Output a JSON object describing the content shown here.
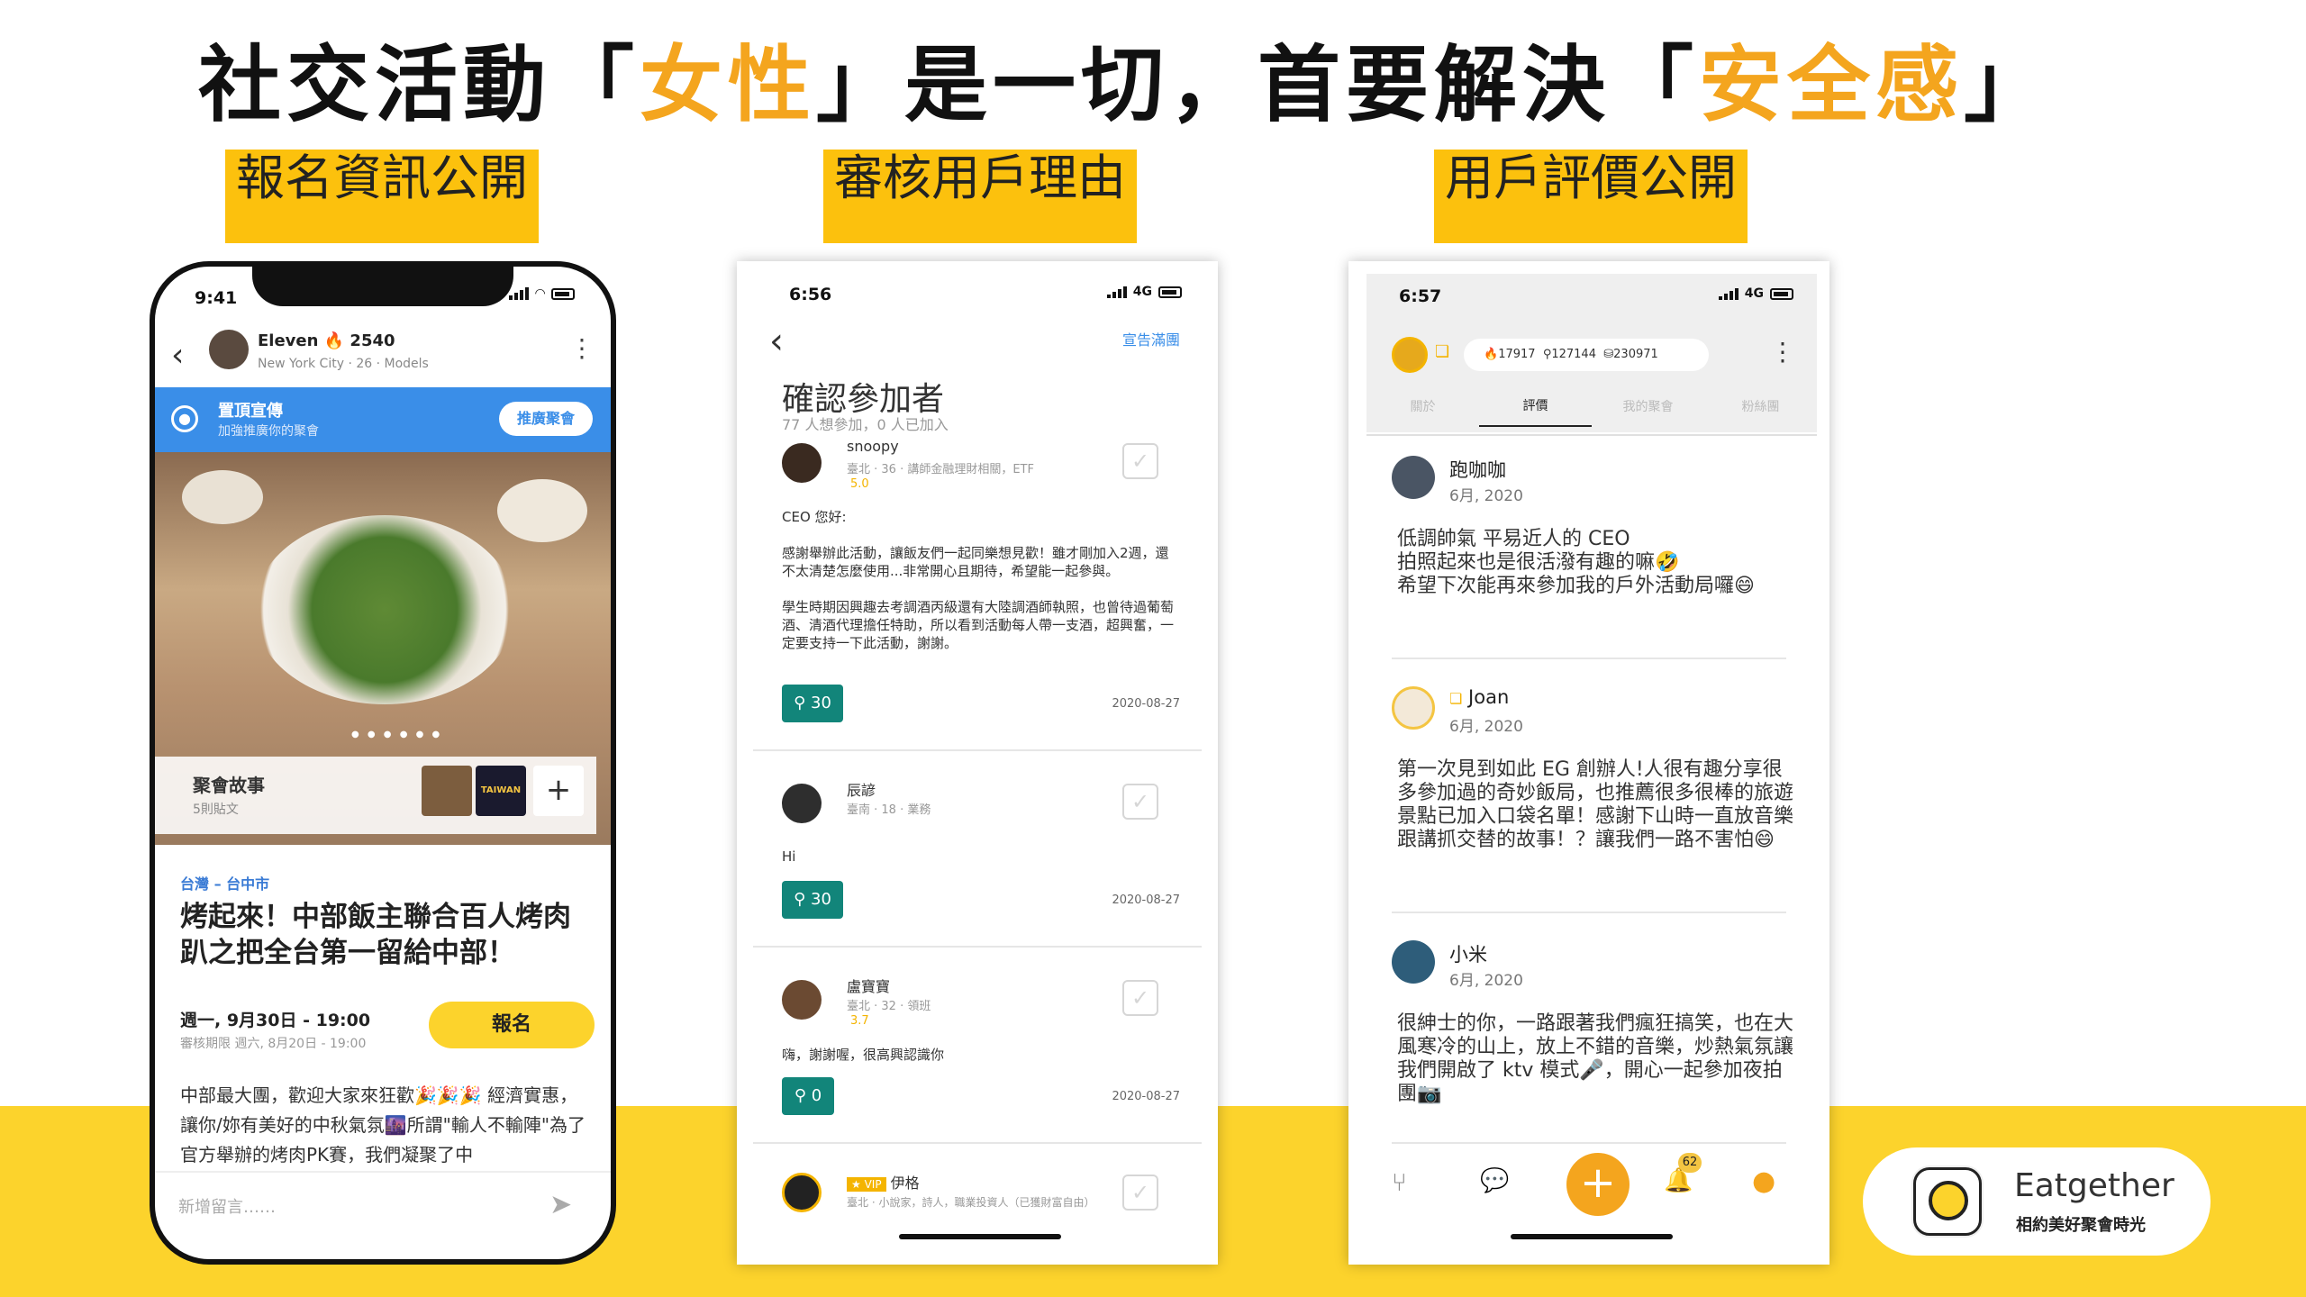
{
  "headline": {
    "part1": "社交活動「",
    "hl1": "女性",
    "part2": "」是一切，首要解決「",
    "hl2": "安全感",
    "part3": "」"
  },
  "tags": [
    "報名資訊公開",
    "審核用戶理由",
    "用戶評價公開"
  ],
  "phone1": {
    "time": "9:41",
    "host": {
      "name": "Eleven",
      "score": "2540",
      "meta": "New York City · 26 · Models"
    },
    "promo": {
      "title": "置頂宣傳",
      "sub": "加強推廣你的聚會",
      "button": "推廣聚會"
    },
    "story": {
      "title": "聚會故事",
      "count": "5則貼文",
      "thumb2_text": "TAIWAN"
    },
    "location": "台灣 – 台中市",
    "event_title": "烤起來！中部飯主聯合百人烤肉趴之把全台第一留給中部！",
    "date": "週一, 9月30日 - 19:00",
    "deadline": "審核期限 週六, 8月20日 - 19:00",
    "register_button": "報名",
    "description": "中部最大團，歡迎大家來狂歡🎉🎉🎉 經濟實惠，讓你/妳有美好的中秋氣氛🌆所謂\"輸人不輸陣\"為了官方舉辦的烤肉PK賽，我們凝聚了中",
    "comment_placeholder": "新增留言……"
  },
  "phone2": {
    "time": "6:56",
    "network": "4G",
    "top_right": "宣告滿團",
    "title": "確認參加者",
    "subtitle": "77 人想參加，0 人已加入",
    "applicants": [
      {
        "name": "snoopy",
        "meta": "臺北 · 36 · 講師金融理財相關，ETF",
        "rating": "5.0",
        "message": "CEO 您好:\n\n感謝舉辦此活動，讓飯友們一起同樂想見歡！雖才剛加入2週，還不太清楚怎麼使用...非常開心且期待，希望能一起參與。\n\n學生時期因興趣去考調酒丙級還有大陸調酒師執照，也曾待過葡萄酒、清酒代理擔任特助，所以看到活動每人帶一支酒，超興奮，一定要支持一下此活動，謝謝。",
        "count": "30",
        "date": "2020-08-27"
      },
      {
        "name": "辰諺",
        "meta": "臺南 · 18 · 業務",
        "rating": "",
        "message": "Hi",
        "count": "30",
        "date": "2020-08-27"
      },
      {
        "name": "盧寶寶",
        "meta": "臺北 · 32 · 領班",
        "rating": "3.7",
        "message": "嗨，謝謝喔，很高興認識你",
        "count": "0",
        "date": "2020-08-27"
      },
      {
        "name": "伊格",
        "vip": "VIP",
        "meta": "臺北 · 小說家，詩人，職業投資人（已獲財富自由）",
        "rating": "",
        "message": "",
        "count": "",
        "date": ""
      }
    ]
  },
  "phone3": {
    "time": "6:57",
    "network": "4G",
    "stats": [
      "17917",
      "127144",
      "230971"
    ],
    "tabs": [
      "關於",
      "評價",
      "我的聚會",
      "粉絲團"
    ],
    "reviews": [
      {
        "name": "跑咖咖",
        "date": "6月, 2020",
        "text": "低調帥氣 平易近人的 CEO\n拍照起來也是很活潑有趣的嘛🤣\n希望下次能再來參加我的戶外活動局囉😄"
      },
      {
        "name": "Joan",
        "date": "6月, 2020",
        "text": "第一次見到如此 EG 創辦人!人很有趣分享很多參加過的奇妙飯局，也推薦很多很棒的旅遊景點已加入口袋名單！感謝下山時一直放音樂跟講抓交替的故事！？讓我們一路不害怕😄"
      },
      {
        "name": "小米",
        "date": "6月, 2020",
        "text": "很紳士的你，一路跟著我們瘋狂搞笑，也在大風寒冷的山上，放上不錯的音樂，炒熱氣氛讓我們開啟了 ktv 模式🎤，開心一起參加夜拍團📷"
      }
    ],
    "notif_count": "62"
  },
  "brand": {
    "name": "Eatgether",
    "tagline": "相約美好聚會時光"
  },
  "colors": {
    "accent": "#fcd32c",
    "highlight": "#f4a51e",
    "teal": "#12857a",
    "blue": "#3a8ee8"
  }
}
